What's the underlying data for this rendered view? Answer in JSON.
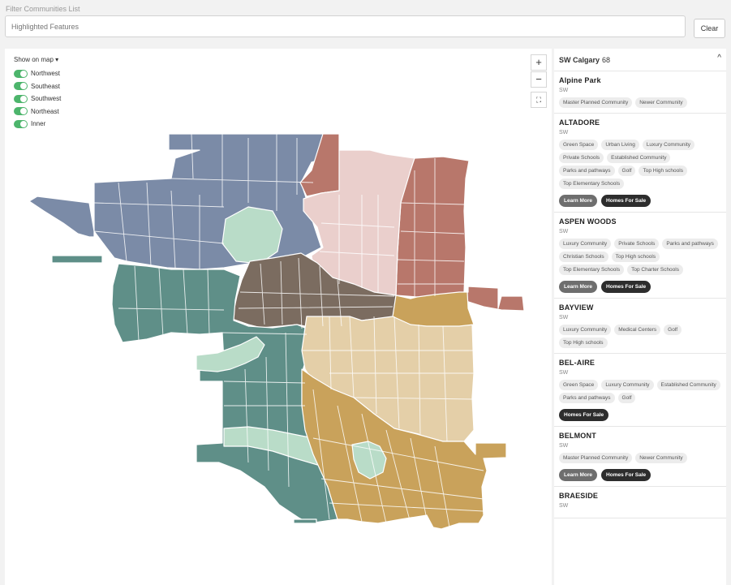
{
  "filter": {
    "label": "Filter Communities List",
    "placeholder": "Highlighted Features",
    "clear_label": "Clear"
  },
  "map": {
    "legend_title": "Show on map",
    "regions": [
      {
        "label": "Northwest",
        "color": "#7a8aa6"
      },
      {
        "label": "Southeast",
        "color": "#c9a15a"
      },
      {
        "label": "Southwest",
        "color": "#5d8f87"
      },
      {
        "label": "Northeast",
        "color": "#b8766a"
      },
      {
        "label": "Inner",
        "color": "#7a6a5e"
      }
    ],
    "zoom_in": "+",
    "zoom_out": "−",
    "fullscreen": "⛶"
  },
  "sidebar": {
    "title": "SW Calgary",
    "count": "68",
    "chevron": "^",
    "communities": [
      {
        "name": "Alpine Park",
        "quadrant": "SW",
        "tags": [
          "Master Planned Community",
          "Newer Community"
        ],
        "buttons": []
      },
      {
        "name": "ALTADORE",
        "quadrant": "SW",
        "tags": [
          "Green Space",
          "Urban Living",
          "Luxury Community",
          "Private Schools",
          "Established Community",
          "Parks and pathways",
          "Golf",
          "Top High schools",
          "Top Elementary Schools"
        ],
        "buttons": [
          "Learn More",
          "Homes For Sale"
        ]
      },
      {
        "name": "ASPEN WOODS",
        "quadrant": "SW",
        "tags": [
          "Luxury Community",
          "Private Schools",
          "Parks and pathways",
          "Christian Schools",
          "Top High schools",
          "Top Elementary Schools",
          "Top Charter Schools"
        ],
        "buttons": [
          "Learn More",
          "Homes For Sale"
        ]
      },
      {
        "name": "BAYVIEW",
        "quadrant": "SW",
        "tags": [
          "Luxury Community",
          "Medical Centers",
          "Golf",
          "Top High schools"
        ],
        "buttons": []
      },
      {
        "name": "BEL-AIRE",
        "quadrant": "SW",
        "tags": [
          "Green Space",
          "Luxury Community",
          "Established Community",
          "Parks and pathways",
          "Golf"
        ],
        "buttons": [
          "Homes For Sale"
        ]
      },
      {
        "name": "BELMONT",
        "quadrant": "SW",
        "tags": [
          "Master Planned Community",
          "Newer Community"
        ],
        "buttons": [
          "Learn More",
          "Homes For Sale"
        ]
      },
      {
        "name": "BRAESIDE",
        "quadrant": "SW",
        "tags": [],
        "buttons": []
      }
    ]
  }
}
